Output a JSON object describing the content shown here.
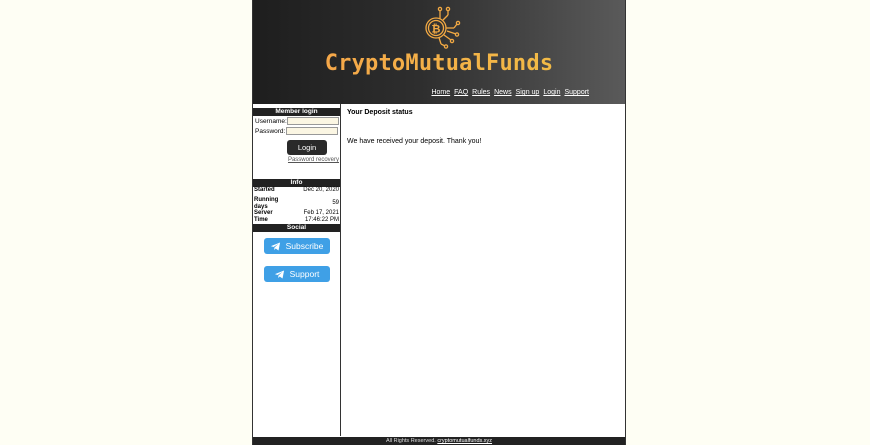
{
  "header": {
    "brand": "CryptoMutualFunds",
    "brand_gradient": [
      "#f6a14a",
      "#f1c145"
    ],
    "logo_icon": "bitcoin-circuit-logo"
  },
  "nav": [
    "Home",
    "FAQ",
    "Rules",
    "News",
    "Sign up",
    "Login",
    "Support"
  ],
  "login": {
    "title": "Member login",
    "username_label": "Username:",
    "password_label": "Password:",
    "username_value": "",
    "password_value": "",
    "button": "Login",
    "recovery": "Password recovery"
  },
  "info": {
    "title": "Info",
    "rows": [
      {
        "k": "Started",
        "v": "Dec 20, 2020"
      },
      {
        "k": "Running days",
        "v": "59"
      },
      {
        "k": "Server Time",
        "v": "Feb 17, 2021 17:46:22 PM"
      }
    ]
  },
  "social": {
    "title": "Social",
    "buttons": [
      "Subscribe",
      "Support"
    ],
    "button_color": "#3fa0e6"
  },
  "main": {
    "heading": "Your Deposit status",
    "message": "We have received your deposit. Thank you!"
  },
  "footer": {
    "text": "All Rights Reserved.",
    "link": "cryptomutualfunds.xyz"
  }
}
